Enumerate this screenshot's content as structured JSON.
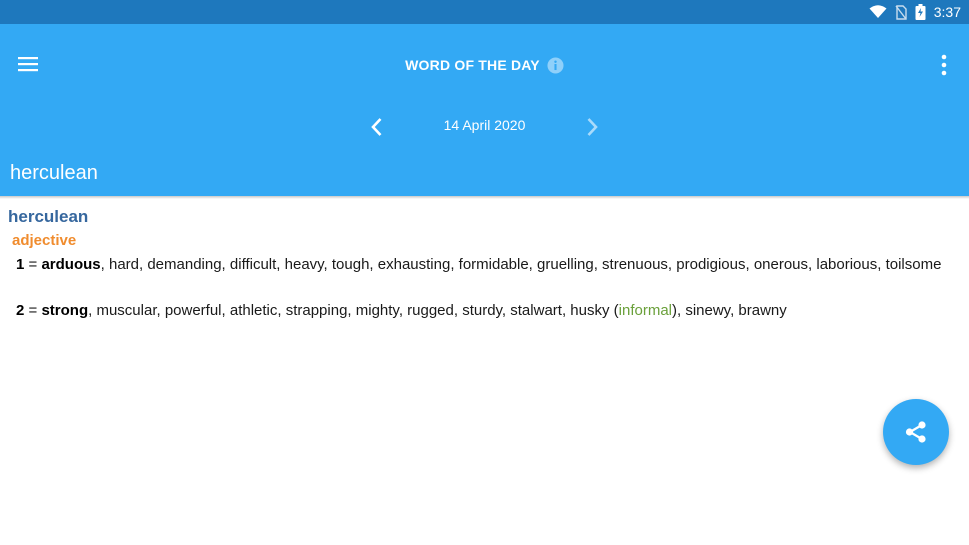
{
  "status_bar": {
    "time": "3:37",
    "icons": [
      "wifi-icon",
      "no-sim-icon",
      "battery-charging-icon"
    ]
  },
  "app_bar": {
    "title": "WORD OF THE DAY",
    "icons": [
      "menu-icon",
      "info-icon",
      "more-vert-icon"
    ],
    "color": "#33a9f4"
  },
  "date_nav": {
    "date": "14 April 2020",
    "icons": [
      "chevron-left-icon",
      "chevron-right-icon"
    ]
  },
  "banner": {
    "word": "herculean"
  },
  "entry": {
    "headword": "herculean",
    "part_of_speech": "adjective",
    "senses": [
      {
        "number": "1",
        "equals": "=",
        "key": "arduous",
        "rest": ", hard, demanding, difficult, heavy, tough, exhausting, formidable, gruelling, strenuous, prodigious, onerous, laborious, toilsome"
      },
      {
        "number": "2",
        "equals": "=",
        "key": "strong",
        "rest_before": ", muscular, powerful, athletic, strapping, mighty, rugged, sturdy, stalwart, husky (",
        "label": "informal",
        "rest_after": "), sinewy, brawny"
      }
    ]
  },
  "fab": {
    "icon": "share-icon"
  },
  "colors": {
    "status_bar": "#1e78bd",
    "headword": "#36679e",
    "part_of_speech": "#f08c2e",
    "register_label": "#6aa03a"
  }
}
